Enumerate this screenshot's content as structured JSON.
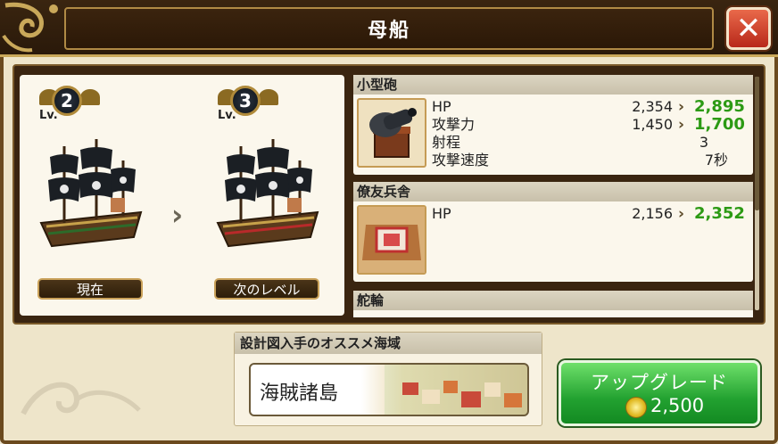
{
  "window": {
    "title": "母船"
  },
  "current": {
    "level": "2",
    "lv_label": "Lv.",
    "button": "現在"
  },
  "next": {
    "level": "3",
    "lv_label": "Lv.",
    "button": "次のレベル"
  },
  "upgrades": [
    {
      "name": "小型砲",
      "icon": "cannon-icon",
      "stats": [
        {
          "name": "HP",
          "current": "2,354",
          "next": "2,895"
        },
        {
          "name": "攻撃力",
          "current": "1,450",
          "next": "1,700"
        },
        {
          "name": "射程",
          "current": "3",
          "next": ""
        },
        {
          "name": "攻撃速度",
          "current": "7秒",
          "next": ""
        }
      ]
    },
    {
      "name": "僚友兵舎",
      "icon": "barracks-icon",
      "stats": [
        {
          "name": "HP",
          "current": "2,156",
          "next": "2,352"
        }
      ]
    },
    {
      "name": "舵輪",
      "icon": "helm-icon",
      "stats": []
    }
  ],
  "region": {
    "header": "設計図入手のオススメ海域",
    "name": "海賊諸島"
  },
  "upgrade_button": {
    "label": "アップグレード",
    "cost": "2,500"
  },
  "colors": {
    "accent_green": "#2c9a14",
    "frame_brown": "#3a2510",
    "gold": "#c9a85a"
  }
}
